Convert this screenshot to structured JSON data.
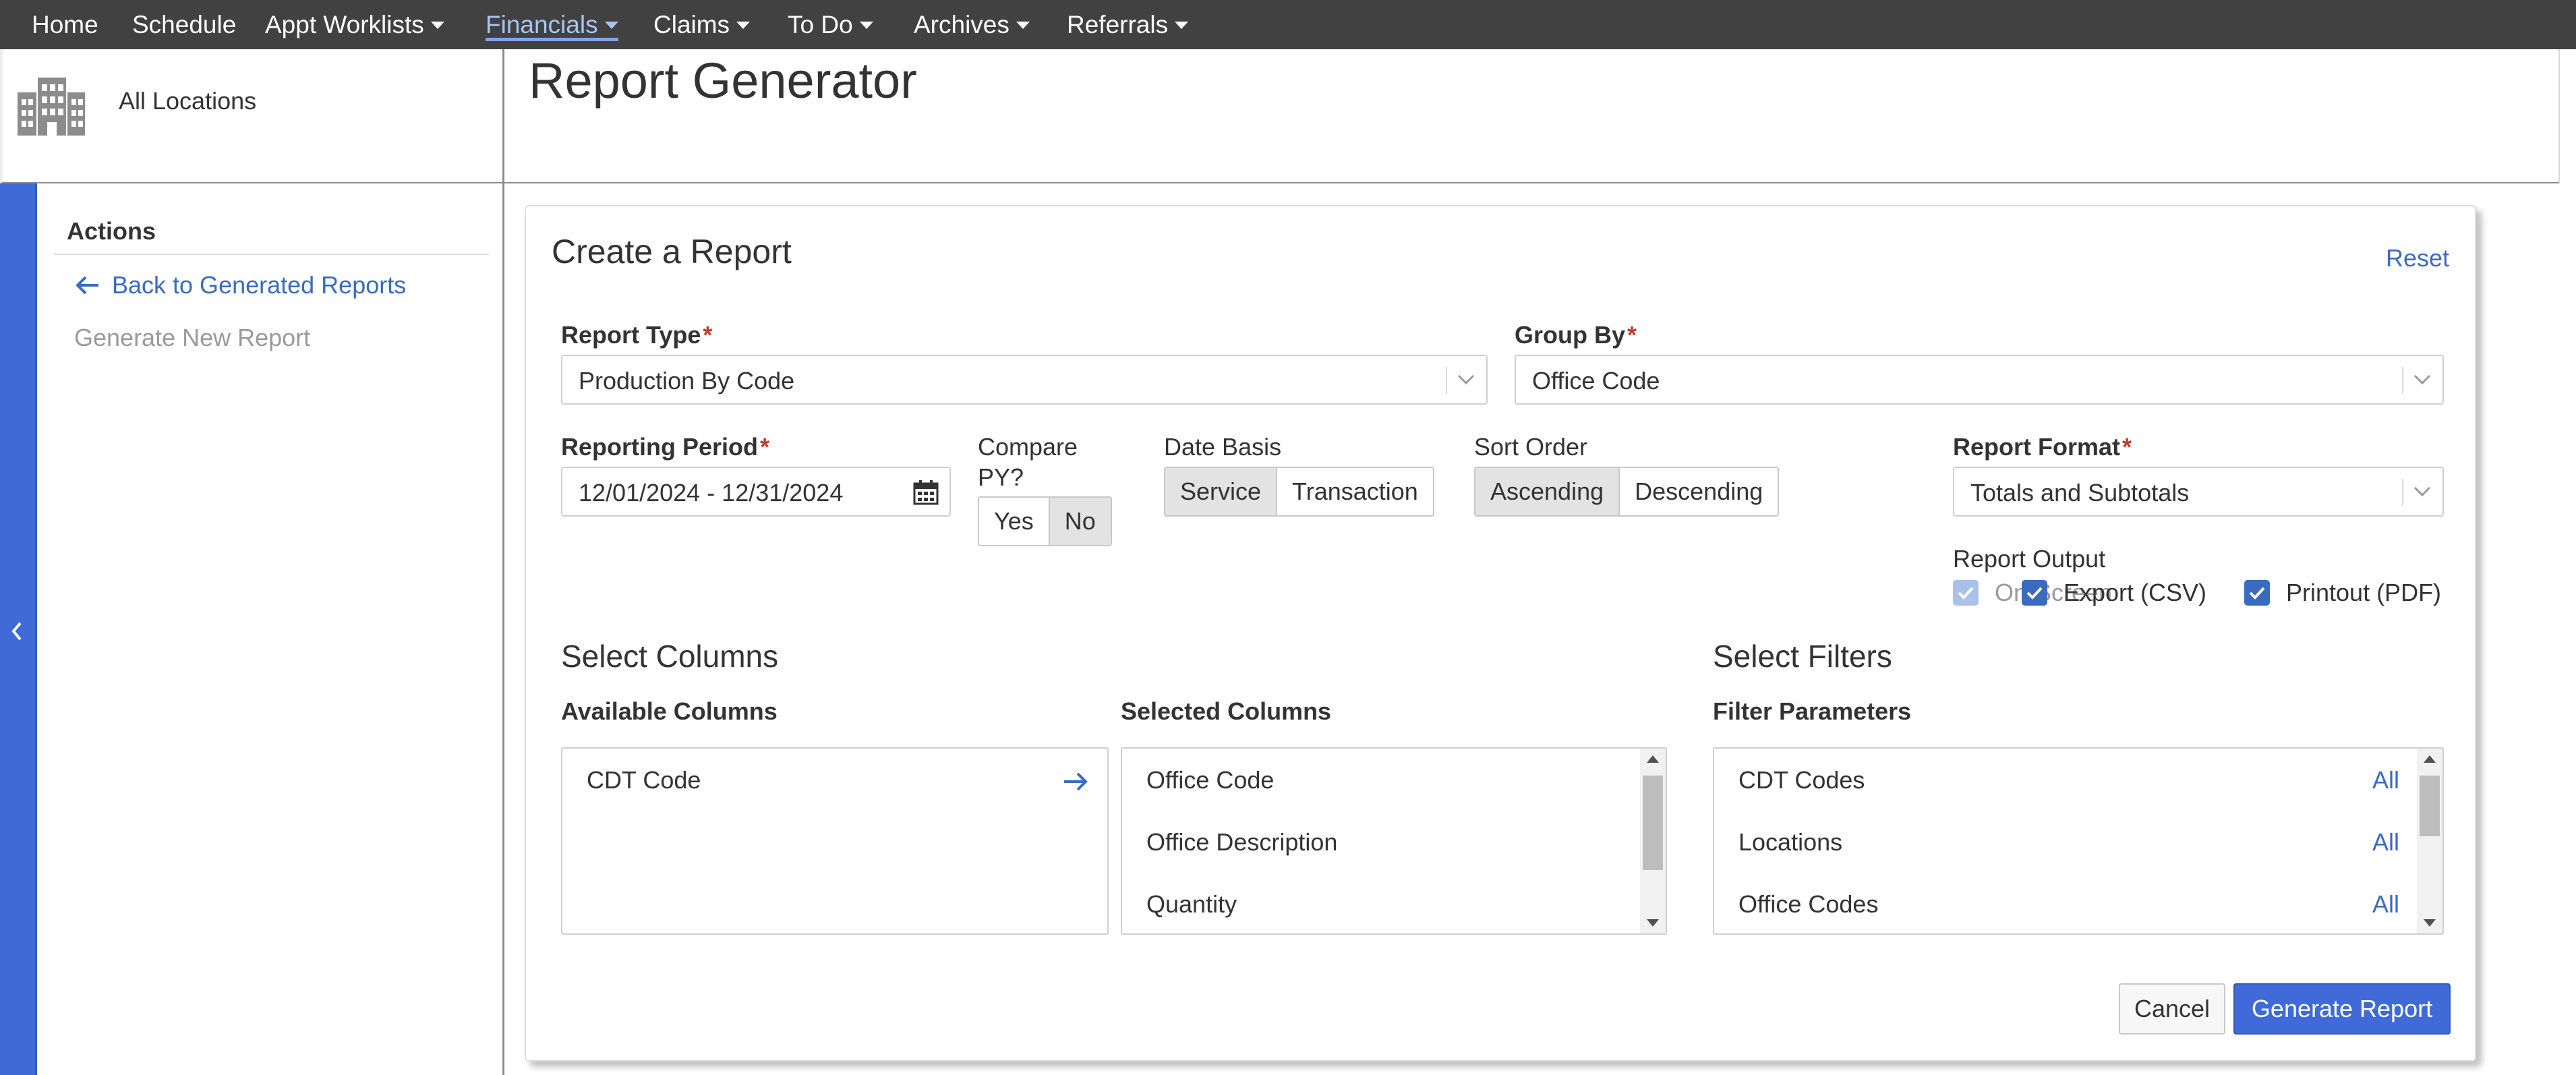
{
  "nav": {
    "items": [
      {
        "label": "Home"
      },
      {
        "label": "Schedule"
      },
      {
        "label": "Appt Worklists"
      },
      {
        "label": "Financials"
      },
      {
        "label": "Claims"
      },
      {
        "label": "To Do"
      },
      {
        "label": "Archives"
      },
      {
        "label": "Referrals"
      }
    ],
    "active": "Financials"
  },
  "location": {
    "label": "All Locations",
    "icon": "building-icon"
  },
  "header": {
    "title": "Report Generator"
  },
  "sidebar": {
    "collapse_icon": "chevron-left-icon",
    "actions_title": "Actions",
    "back_link": "Back to Generated Reports",
    "generate_new": "Generate New Report"
  },
  "card": {
    "title": "Create a Report",
    "reset": "Reset",
    "report_type": {
      "label": "Report Type",
      "value": "Production By Code"
    },
    "group_by": {
      "label": "Group By",
      "value": "Office Code"
    },
    "reporting_period": {
      "label": "Reporting Period",
      "value": "12/01/2024 - 12/31/2024"
    },
    "compare_py": {
      "label_line1": "Compare",
      "label_line2": "PY?",
      "options": [
        "Yes",
        "No"
      ],
      "selected": "No"
    },
    "date_basis": {
      "label": "Date Basis",
      "options": [
        "Service",
        "Transaction"
      ],
      "selected": "Service"
    },
    "sort_order": {
      "label": "Sort Order",
      "options": [
        "Ascending",
        "Descending"
      ],
      "selected": "Ascending"
    },
    "report_format": {
      "label": "Report Format",
      "value": "Totals and Subtotals"
    },
    "report_output": {
      "label": "Report Output",
      "options": [
        {
          "label": "On-Screen",
          "checked": true,
          "disabled": true
        },
        {
          "label": "Export (CSV)",
          "checked": true,
          "disabled": false
        },
        {
          "label": "Printout (PDF)",
          "checked": true,
          "disabled": false
        }
      ]
    },
    "select_columns": {
      "title": "Select Columns",
      "available_label": "Available Columns",
      "available": [
        "CDT Code"
      ],
      "selected_label": "Selected Columns",
      "selected": [
        "Office Code",
        "Office Description",
        "Quantity"
      ]
    },
    "select_filters": {
      "title": "Select Filters",
      "params_label": "Filter Parameters",
      "params": [
        {
          "name": "CDT Codes",
          "value": "All"
        },
        {
          "name": "Locations",
          "value": "All"
        },
        {
          "name": "Office Codes",
          "value": "All"
        }
      ]
    },
    "cancel": "Cancel",
    "generate": "Generate Report"
  },
  "colors": {
    "nav_bg": "#414141",
    "accent": "#3f6ad8",
    "link": "#3a6bbf",
    "required": "#c0392b"
  }
}
